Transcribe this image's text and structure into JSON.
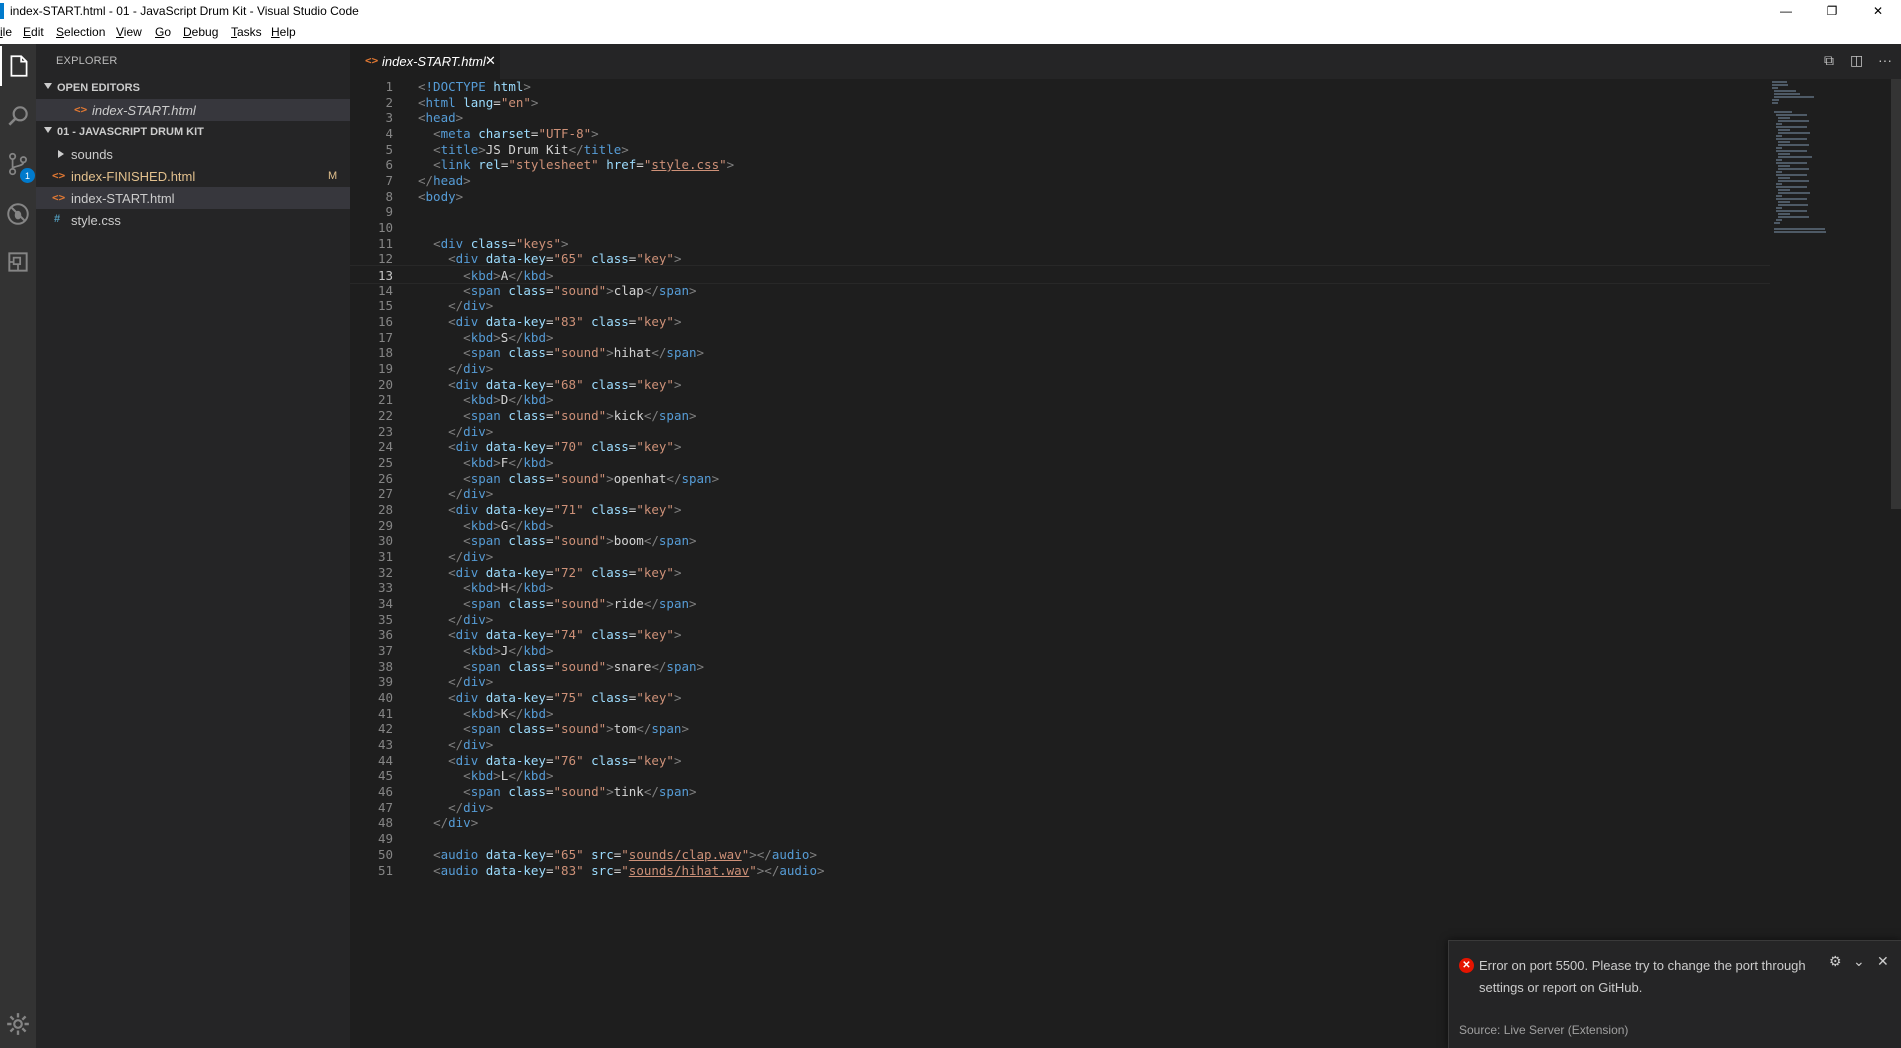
{
  "window": {
    "title": "index-START.html - 01 - JavaScript Drum Kit - Visual Studio Code",
    "controls": [
      "—",
      "❐",
      "✕"
    ]
  },
  "menu": [
    "ile",
    "Edit",
    "Selection",
    "View",
    "Go",
    "Debug",
    "Tasks",
    "Help"
  ],
  "sidebar": {
    "title": "EXPLORER",
    "open_editors_label": "OPEN EDITORS",
    "open_editors": [
      {
        "name": "index-START.html"
      }
    ],
    "folder_label": "01 - JAVASCRIPT DRUM KIT",
    "items": [
      {
        "name": "sounds",
        "type": "folder"
      },
      {
        "name": "index-FINISHED.html",
        "type": "html",
        "badge": "M"
      },
      {
        "name": "index-START.html",
        "type": "html"
      },
      {
        "name": "style.css",
        "type": "css"
      }
    ]
  },
  "activity": {
    "scm_badge": "1"
  },
  "tabs": [
    {
      "name": "index-START.html",
      "close": "✕"
    }
  ],
  "editor": {
    "current_line": 13,
    "lines": [
      {
        "n": "1",
        "text": "<!DOCTYPE html>"
      },
      {
        "n": "2",
        "text": "<html lang=\"en\">"
      },
      {
        "n": "3",
        "text": "<head>"
      },
      {
        "n": "4",
        "text": "  <meta charset=\"UTF-8\">"
      },
      {
        "n": "5",
        "text": "  <title>JS Drum Kit</title>"
      },
      {
        "n": "6",
        "text": "  <link rel=\"stylesheet\" href=\"style.css\">"
      },
      {
        "n": "7",
        "text": "</head>"
      },
      {
        "n": "8",
        "text": "<body>"
      },
      {
        "n": "9",
        "text": ""
      },
      {
        "n": "10",
        "text": ""
      },
      {
        "n": "11",
        "text": "  <div class=\"keys\">"
      },
      {
        "n": "12",
        "text": "    <div data-key=\"65\" class=\"key\">"
      },
      {
        "n": "13",
        "text": "      <kbd>A</kbd>"
      },
      {
        "n": "14",
        "text": "      <span class=\"sound\">clap</span>"
      },
      {
        "n": "15",
        "text": "    </div>"
      },
      {
        "n": "16",
        "text": "    <div data-key=\"83\" class=\"key\">"
      },
      {
        "n": "17",
        "text": "      <kbd>S</kbd>"
      },
      {
        "n": "18",
        "text": "      <span class=\"sound\">hihat</span>"
      },
      {
        "n": "19",
        "text": "    </div>"
      },
      {
        "n": "20",
        "text": "    <div data-key=\"68\" class=\"key\">"
      },
      {
        "n": "21",
        "text": "      <kbd>D</kbd>"
      },
      {
        "n": "22",
        "text": "      <span class=\"sound\">kick</span>"
      },
      {
        "n": "23",
        "text": "    </div>"
      },
      {
        "n": "24",
        "text": "    <div data-key=\"70\" class=\"key\">"
      },
      {
        "n": "25",
        "text": "      <kbd>F</kbd>"
      },
      {
        "n": "26",
        "text": "      <span class=\"sound\">openhat</span>"
      },
      {
        "n": "27",
        "text": "    </div>"
      },
      {
        "n": "28",
        "text": "    <div data-key=\"71\" class=\"key\">"
      },
      {
        "n": "29",
        "text": "      <kbd>G</kbd>"
      },
      {
        "n": "30",
        "text": "      <span class=\"sound\">boom</span>"
      },
      {
        "n": "31",
        "text": "    </div>"
      },
      {
        "n": "32",
        "text": "    <div data-key=\"72\" class=\"key\">"
      },
      {
        "n": "33",
        "text": "      <kbd>H</kbd>"
      },
      {
        "n": "34",
        "text": "      <span class=\"sound\">ride</span>"
      },
      {
        "n": "35",
        "text": "    </div>"
      },
      {
        "n": "36",
        "text": "    <div data-key=\"74\" class=\"key\">"
      },
      {
        "n": "37",
        "text": "      <kbd>J</kbd>"
      },
      {
        "n": "38",
        "text": "      <span class=\"sound\">snare</span>"
      },
      {
        "n": "39",
        "text": "    </div>"
      },
      {
        "n": "40",
        "text": "    <div data-key=\"75\" class=\"key\">"
      },
      {
        "n": "41",
        "text": "      <kbd>K</kbd>"
      },
      {
        "n": "42",
        "text": "      <span class=\"sound\">tom</span>"
      },
      {
        "n": "43",
        "text": "    </div>"
      },
      {
        "n": "44",
        "text": "    <div data-key=\"76\" class=\"key\">"
      },
      {
        "n": "45",
        "text": "      <kbd>L</kbd>"
      },
      {
        "n": "46",
        "text": "      <span class=\"sound\">tink</span>"
      },
      {
        "n": "47",
        "text": "    </div>"
      },
      {
        "n": "48",
        "text": "  </div>"
      },
      {
        "n": "49",
        "text": ""
      },
      {
        "n": "50",
        "text": "  <audio data-key=\"65\" src=\"sounds/clap.wav\"></audio>"
      },
      {
        "n": "51",
        "text": "  <audio data-key=\"83\" src=\"sounds/hihat.wav\"></audio>"
      }
    ]
  },
  "notification": {
    "message": "Error on port 5500. Please try to change the port through settings or report on GitHub.",
    "source": "Source: Live Server (Extension)",
    "icon": "error-icon"
  },
  "colors": {
    "accent": "#007acc",
    "error": "#e51400",
    "modified": "#e2c08d",
    "html_icon": "#e37933",
    "css_icon": "#519aba"
  }
}
